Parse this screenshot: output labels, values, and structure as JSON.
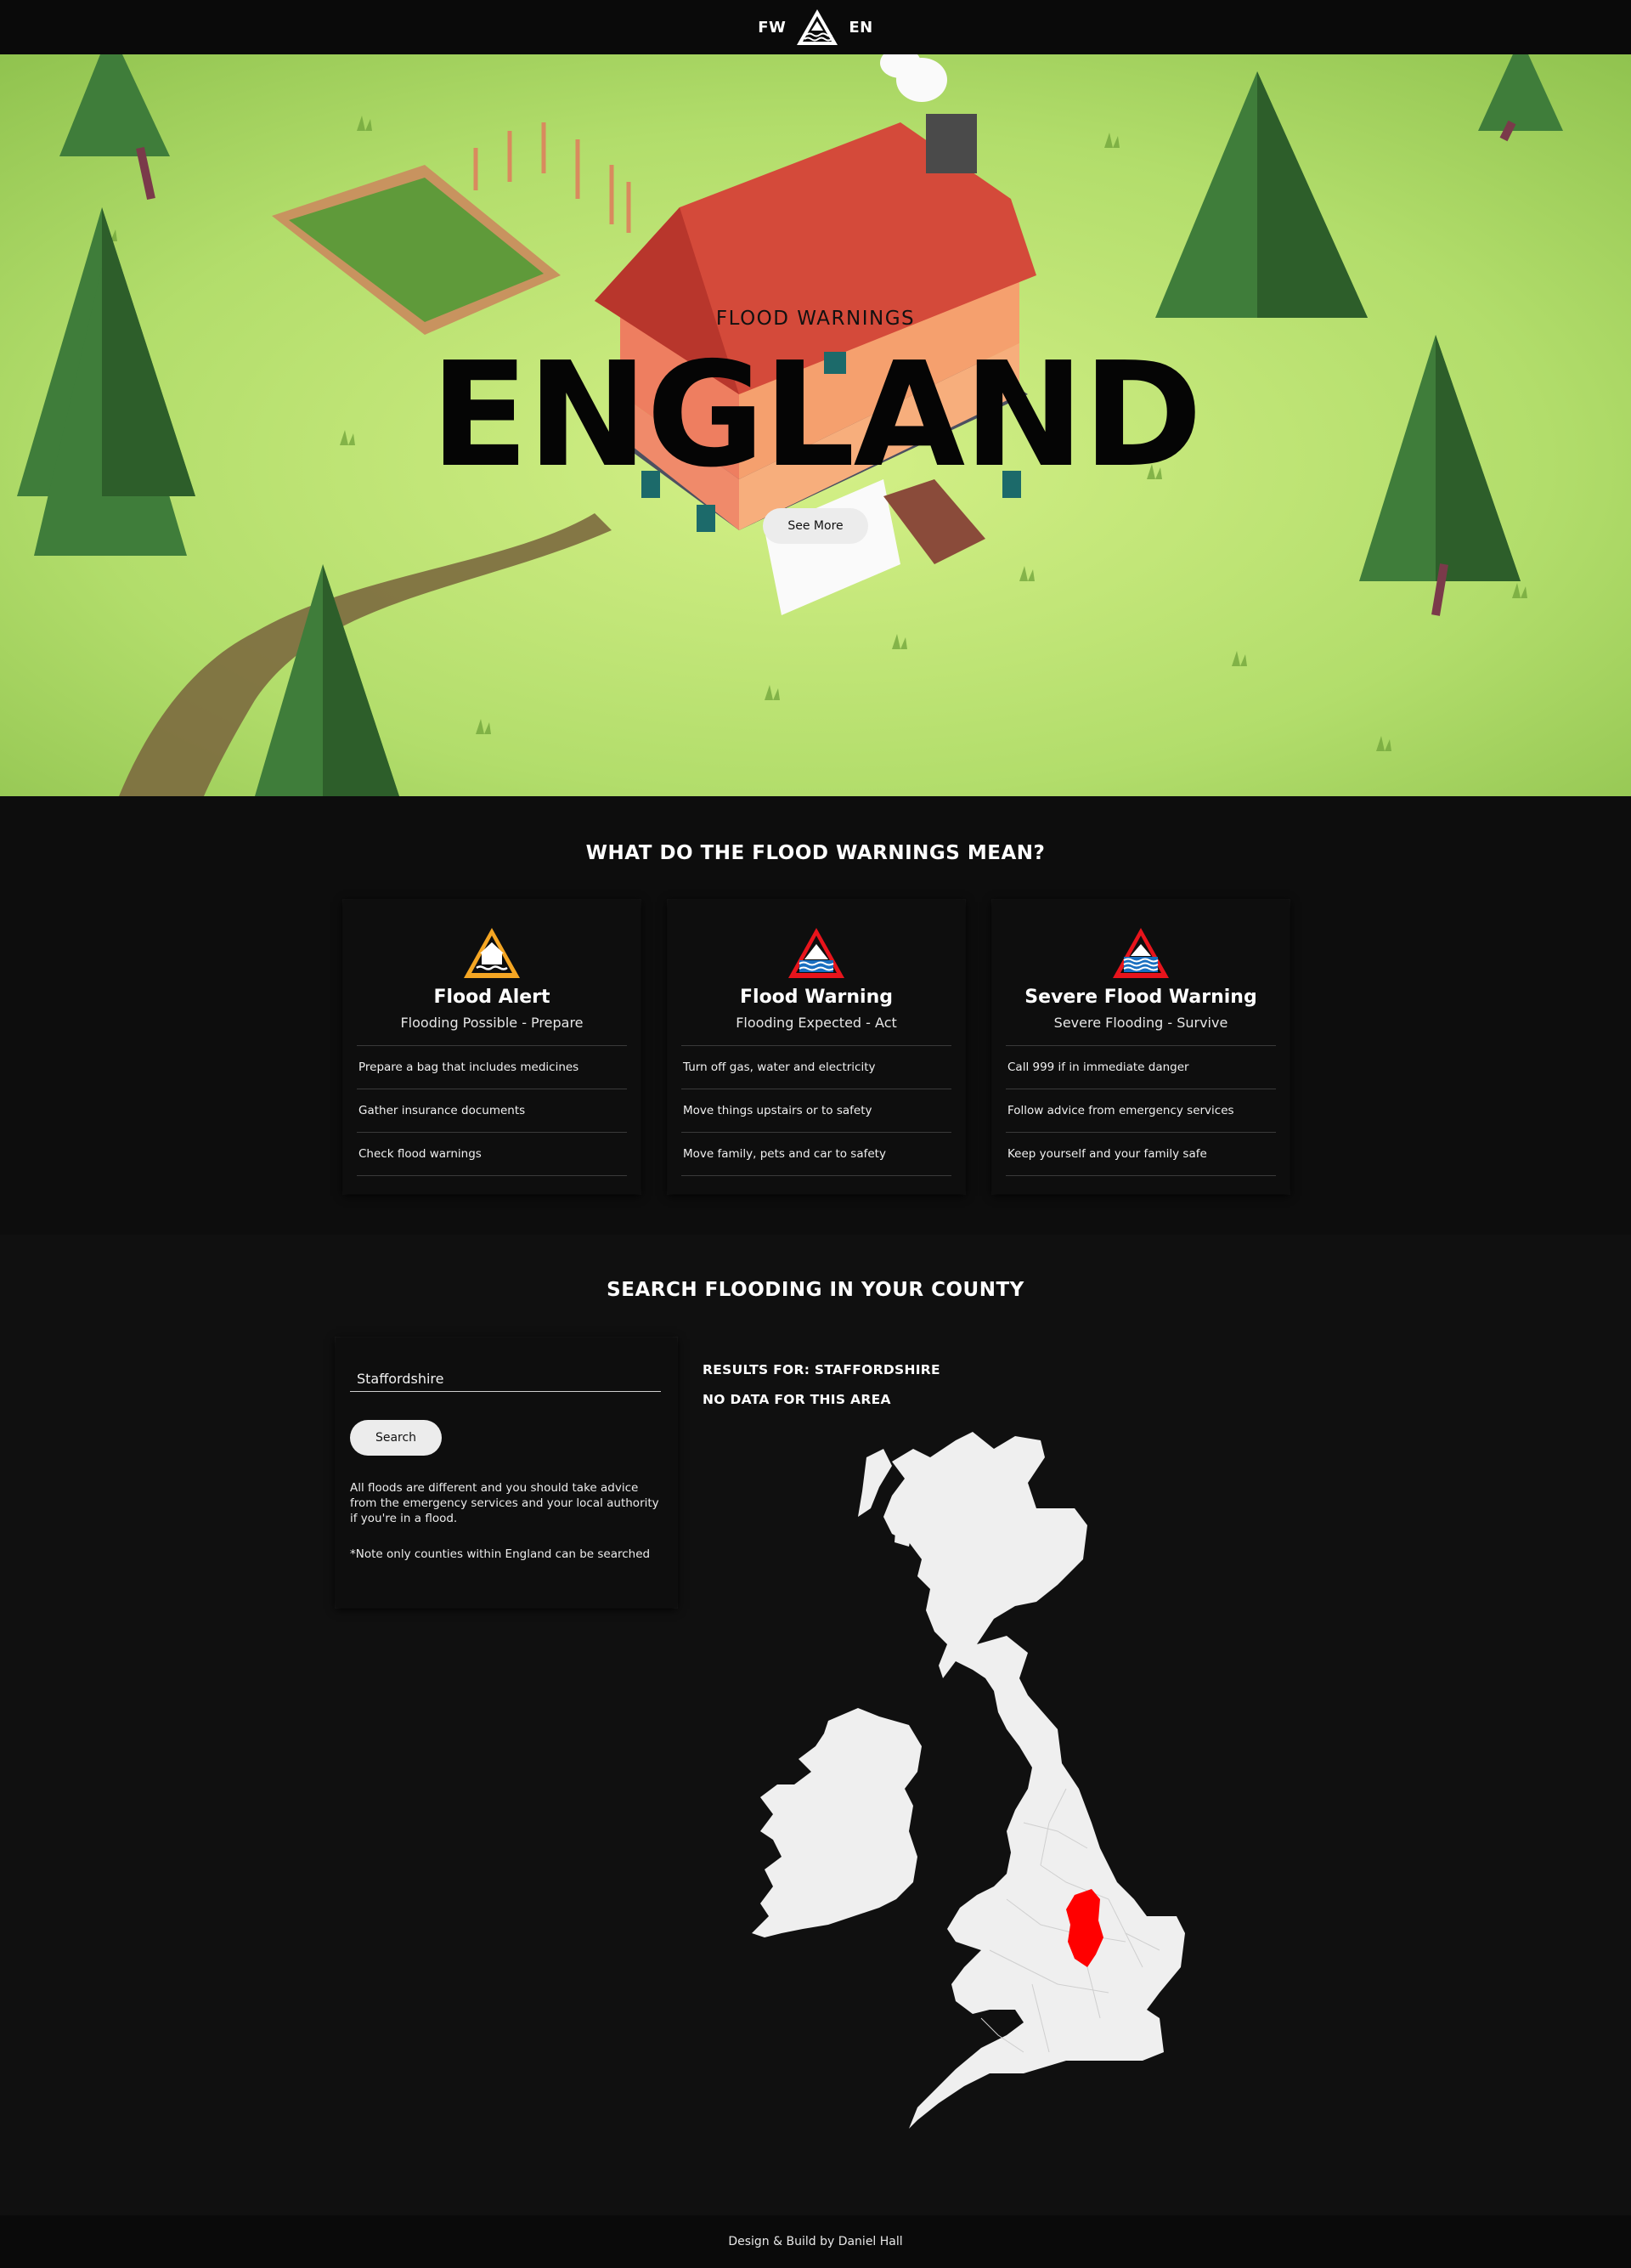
{
  "nav": {
    "left_text": "FW",
    "right_text": "EN"
  },
  "hero": {
    "kicker": "FLOOD WARNINGS",
    "headline": "ENGLAND",
    "cta_label": "See More"
  },
  "meanings": {
    "heading": "WHAT DO THE FLOOD WARNINGS MEAN?",
    "cards": [
      {
        "title": "Flood Alert",
        "subtitle": "Flooding Possible - Prepare",
        "icon": "flood-alert-icon",
        "color": "#f5a623",
        "items": [
          "Prepare a bag that includes medicines",
          "Gather insurance documents",
          "Check flood warnings"
        ]
      },
      {
        "title": "Flood Warning",
        "subtitle": "Flooding Expected - Act",
        "icon": "flood-warning-icon",
        "color": "#e8141c",
        "items": [
          "Turn off gas, water and electricity",
          "Move things upstairs or to safety",
          "Move family, pets and car to safety"
        ]
      },
      {
        "title": "Severe Flood Warning",
        "subtitle": "Severe Flooding - Survive",
        "icon": "severe-flood-warning-icon",
        "color": "#e8141c",
        "items": [
          "Call 999 if in immediate danger",
          "Follow advice from emergency services",
          "Keep yourself and your family safe"
        ]
      }
    ]
  },
  "search": {
    "heading": "SEARCH FLOODING IN YOUR COUNTY",
    "input_value": "Staffordshire",
    "button_label": "Search",
    "advice": "All floods are different and you should take advice from the emergency services and your local authority if you're in a flood.",
    "note": "*Note only counties within England can be searched",
    "results_label": "RESULTS FOR: STAFFORDSHIRE",
    "no_data_label": "NO DATA FOR THIS AREA",
    "highlight_color": "#ff0000",
    "map_color": "#efefef"
  },
  "footer": {
    "credit": "Design & Build by Daniel Hall"
  }
}
